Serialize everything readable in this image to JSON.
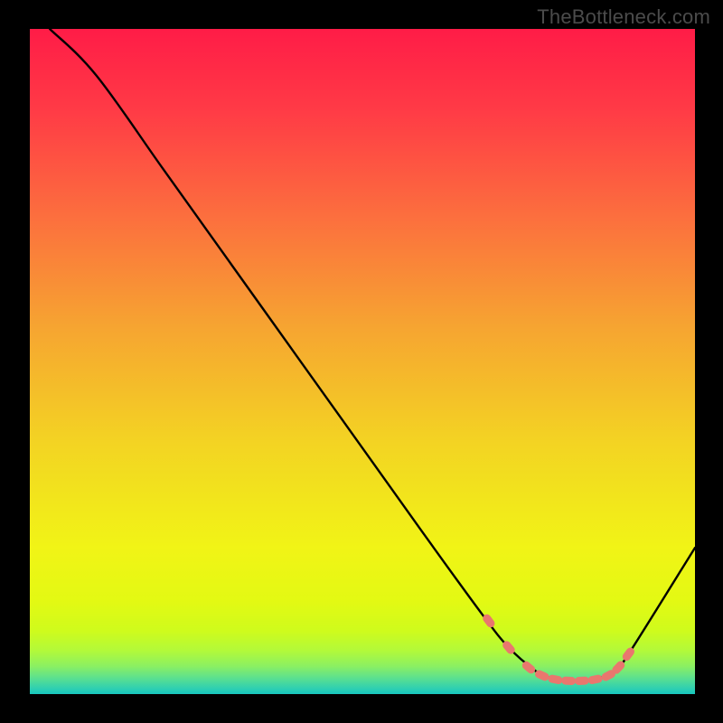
{
  "watermark": "TheBottleneck.com",
  "chart_data": {
    "type": "line",
    "title": "",
    "xlabel": "",
    "ylabel": "",
    "xlim": [
      0,
      100
    ],
    "ylim": [
      0,
      100
    ],
    "grid": false,
    "legend": false,
    "series": [
      {
        "name": "bottleneck-curve",
        "color": "#000000",
        "x": [
          3,
          10,
          20,
          30,
          40,
          50,
          60,
          68,
          72,
          76,
          78,
          80,
          82,
          84,
          86,
          88,
          90,
          100
        ],
        "y": [
          100,
          93,
          79,
          65,
          51,
          37,
          23,
          12,
          7,
          3.5,
          2.5,
          2,
          2,
          2,
          2.5,
          3.5,
          6,
          22
        ]
      }
    ],
    "markers": {
      "name": "valley-beads",
      "color": "#E9776E",
      "shape": "rounded-rect",
      "x": [
        69,
        72,
        75,
        77,
        79,
        81,
        83,
        85,
        87,
        88.5,
        90
      ],
      "y": [
        11,
        7,
        4,
        2.8,
        2.2,
        2,
        2,
        2.2,
        2.8,
        4,
        6
      ]
    },
    "background_gradient": {
      "stops": [
        {
          "offset": 0.0,
          "color": "#FF1C47"
        },
        {
          "offset": 0.12,
          "color": "#FF3A46"
        },
        {
          "offset": 0.28,
          "color": "#FC6E3E"
        },
        {
          "offset": 0.45,
          "color": "#F6A531"
        },
        {
          "offset": 0.62,
          "color": "#F3D323"
        },
        {
          "offset": 0.78,
          "color": "#F1F416"
        },
        {
          "offset": 0.86,
          "color": "#E3F913"
        },
        {
          "offset": 0.905,
          "color": "#CFFB1C"
        },
        {
          "offset": 0.935,
          "color": "#B2F93A"
        },
        {
          "offset": 0.958,
          "color": "#8BF062"
        },
        {
          "offset": 0.975,
          "color": "#5EE18D"
        },
        {
          "offset": 0.99,
          "color": "#33D1AE"
        },
        {
          "offset": 1.0,
          "color": "#17C7BF"
        }
      ]
    }
  }
}
